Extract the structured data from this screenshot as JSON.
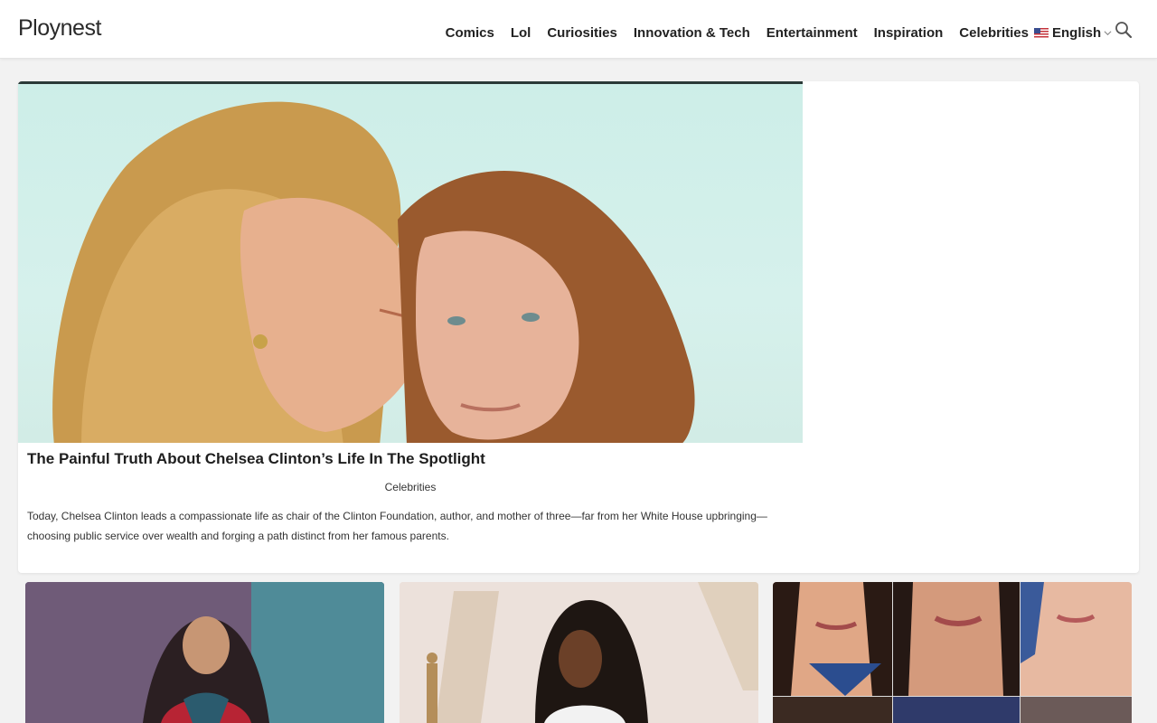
{
  "header": {
    "logo": "Ploynest",
    "nav": [
      "Comics",
      "Lol",
      "Curiosities",
      "Innovation & Tech",
      "Entertainment",
      "Inspiration",
      "Celebrities"
    ],
    "language": "English",
    "icons": {
      "search": "search-icon",
      "language": "flag-us-icon",
      "dropdown": "chevron-down-icon"
    }
  },
  "hero": {
    "title": "The Painful Truth About Chelsea Clinton’s Life In The Spotlight",
    "category": "Celebrities",
    "description": "Today, Chelsea Clinton leads a compassionate life as chair of the Clinton Foundation, author, and mother of three—far from her White House upbringing—choosing public service over wealth and forging a path distinct from her famous parents."
  },
  "colors": {
    "accent": "#2b3a38",
    "background": "#f2f2f2"
  }
}
